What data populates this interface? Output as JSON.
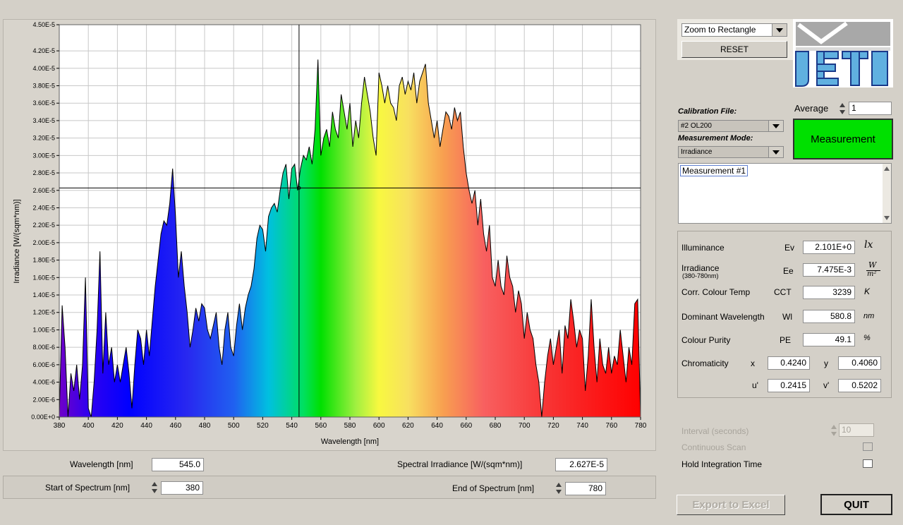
{
  "zoom": {
    "selected": "Zoom to Rectangle"
  },
  "reset_label": "RESET",
  "logo": {
    "text": "JETI"
  },
  "calibration": {
    "label": "Calibration File:",
    "selected": "#2  OL200"
  },
  "measurement_mode": {
    "label": "Measurement Mode:",
    "selected": "Irradiance"
  },
  "average": {
    "label": "Average",
    "value": "1"
  },
  "measure_button": "Measurement",
  "measurement_list": [
    "Measurement #1"
  ],
  "results": {
    "illuminance": {
      "label": "Illuminance",
      "symbol": "Ev",
      "value": "2.101E+0",
      "unit": "lx"
    },
    "irradiance": {
      "label": "Irradiance",
      "sublabel": "(380-780nm)",
      "symbol": "Ee",
      "value": "7.475E-3",
      "unit_num": "W",
      "unit_den": "m²"
    },
    "cct": {
      "label": "Corr. Colour Temp",
      "symbol": "CCT",
      "value": "3239",
      "unit": "K"
    },
    "dominant": {
      "label": "Dominant Wavelength",
      "symbol": "Wl",
      "value": "580.8",
      "unit": "nm"
    },
    "purity": {
      "label": "Colour Purity",
      "symbol": "PE",
      "value": "49.1",
      "unit": "%"
    },
    "chromaticity": {
      "label": "Chromaticity",
      "x_label": "x",
      "x": "0.4240",
      "y_label": "y",
      "y": "0.4060",
      "u_label": "u'",
      "u": "0.2415",
      "v_label": "v'",
      "v": "0.5202"
    }
  },
  "interval": {
    "label": "Interval  (seconds)",
    "value": "10"
  },
  "continuous_scan": {
    "label": "Continuous Scan",
    "checked": false
  },
  "hold_integration": {
    "label": "Hold Integration Time",
    "checked": false
  },
  "export_label": "Export to Excel",
  "quit_label": "QUIT",
  "cursor": {
    "wavelength_label": "Wavelength [nm]",
    "wavelength": "545.0",
    "irradiance_label": "Spectral Irradiance [W/(sqm*nm)]",
    "irradiance": "2.627E-5"
  },
  "range": {
    "start_label": "Start of Spectrum [nm]",
    "start": "380",
    "end_label": "End of Spectrum [nm]",
    "end": "780"
  },
  "chart_data": {
    "type": "area",
    "title": "",
    "xlabel": "Wavelength [nm]",
    "ylabel": "Irradiance [W/(sqm*nm)]",
    "xlim": [
      380,
      780
    ],
    "ylim": [
      0,
      4.5e-05
    ],
    "grid": true,
    "fill": "visible-spectrum gradient",
    "x_ticks": [
      "380",
      "400",
      "420",
      "440",
      "460",
      "480",
      "500",
      "520",
      "540",
      "560",
      "580",
      "600",
      "620",
      "640",
      "660",
      "680",
      "700",
      "720",
      "740",
      "760",
      "780"
    ],
    "y_ticks": [
      "0.00E+0",
      "2.00E-6",
      "4.00E-6",
      "6.00E-6",
      "8.00E-6",
      "1.00E-5",
      "1.20E-5",
      "1.40E-5",
      "1.60E-5",
      "1.80E-5",
      "2.00E-5",
      "2.20E-5",
      "2.40E-5",
      "2.60E-5",
      "2.80E-5",
      "3.00E-5",
      "3.20E-5",
      "3.40E-5",
      "3.60E-5",
      "3.80E-5",
      "4.00E-5",
      "4.20E-5",
      "4.50E-5"
    ],
    "cursor": {
      "x": 545.0,
      "y": 2.627e-05
    },
    "x": [
      380,
      382,
      384,
      386,
      388,
      390,
      392,
      394,
      396,
      398,
      400,
      402,
      404,
      406,
      408,
      410,
      412,
      414,
      416,
      418,
      420,
      422,
      424,
      426,
      428,
      430,
      432,
      434,
      436,
      438,
      440,
      442,
      444,
      446,
      448,
      450,
      452,
      454,
      456,
      458,
      460,
      462,
      464,
      466,
      468,
      470,
      472,
      474,
      476,
      478,
      480,
      482,
      484,
      486,
      488,
      490,
      492,
      494,
      496,
      498,
      500,
      502,
      504,
      506,
      508,
      510,
      512,
      514,
      516,
      518,
      520,
      522,
      524,
      526,
      528,
      530,
      532,
      534,
      536,
      538,
      540,
      542,
      544,
      546,
      548,
      550,
      552,
      554,
      556,
      558,
      560,
      562,
      564,
      566,
      568,
      570,
      572,
      574,
      576,
      578,
      580,
      582,
      584,
      586,
      588,
      590,
      592,
      594,
      596,
      598,
      600,
      602,
      604,
      606,
      608,
      610,
      612,
      614,
      616,
      618,
      620,
      622,
      624,
      626,
      628,
      630,
      632,
      634,
      636,
      638,
      640,
      642,
      644,
      646,
      648,
      650,
      652,
      654,
      656,
      658,
      660,
      662,
      664,
      666,
      668,
      670,
      672,
      674,
      676,
      678,
      680,
      682,
      684,
      686,
      688,
      690,
      692,
      694,
      696,
      698,
      700,
      702,
      704,
      706,
      708,
      710,
      712,
      714,
      716,
      718,
      720,
      722,
      724,
      726,
      728,
      730,
      732,
      734,
      736,
      738,
      740,
      742,
      744,
      746,
      748,
      750,
      752,
      754,
      756,
      758,
      760,
      762,
      764,
      766,
      768,
      770,
      772,
      774,
      776,
      778,
      780
    ],
    "values": [
      0.0,
      1.28e-05,
      8e-06,
      0.0,
      5e-06,
      3e-06,
      6e-06,
      2e-06,
      6e-06,
      1.6e-05,
      1e-06,
      0.0,
      4e-06,
      1e-05,
      1.9e-05,
      5e-06,
      1.2e-05,
      6e-06,
      8e-06,
      4e-06,
      6e-06,
      4e-06,
      6e-06,
      8e-06,
      5e-06,
      1e-06,
      6e-06,
      1e-05,
      9e-06,
      6e-06,
      1e-05,
      7e-06,
      1.1e-05,
      1.5e-05,
      1.8e-05,
      2.1e-05,
      2.25e-05,
      2.2e-05,
      2.45e-05,
      2.85e-05,
      2.3e-05,
      1.6e-05,
      1.9e-05,
      1.5e-05,
      1.2e-05,
      8e-06,
      1e-05,
      1.25e-05,
      1.1e-05,
      1.3e-05,
      1.25e-05,
      1e-05,
      9e-06,
      1.05e-05,
      1.2e-05,
      8e-06,
      6e-06,
      1e-05,
      1.2e-05,
      8e-06,
      7e-06,
      1.05e-05,
      1.3e-05,
      1e-05,
      1.25e-05,
      1.4e-05,
      1.5e-05,
      1.7e-05,
      2.05e-05,
      2.2e-05,
      2.15e-05,
      1.9e-05,
      2.3e-05,
      2.4e-05,
      2.45e-05,
      2.35e-05,
      2.6e-05,
      2.8e-05,
      2.9e-05,
      2.5e-05,
      2.85e-05,
      2.9e-05,
      2.6e-05,
      2.85e-05,
      3e-05,
      2.95e-05,
      3.1e-05,
      2.9e-05,
      3.3e-05,
      4.1e-05,
      3e-05,
      3.2e-05,
      3.3e-05,
      3.1e-05,
      3.5e-05,
      3.3e-05,
      3.2e-05,
      3.7e-05,
      3.5e-05,
      3.3e-05,
      3.6e-05,
      3.1e-05,
      3.4e-05,
      3.2e-05,
      3.6e-05,
      3.9e-05,
      3.7e-05,
      3.5e-05,
      3.2e-05,
      3e-05,
      3.95e-05,
      3.8e-05,
      3.6e-05,
      3.8e-05,
      3.6e-05,
      3.55e-05,
      3.4e-05,
      3.8e-05,
      3.9e-05,
      3.7e-05,
      3.85e-05,
      3.75e-05,
      3.95e-05,
      3.6e-05,
      3.85e-05,
      3.95e-05,
      4.05e-05,
      3.6e-05,
      3.4e-05,
      3.2e-05,
      3.4e-05,
      3.1e-05,
      3.3e-05,
      3.5e-05,
      3.45e-05,
      3.3e-05,
      3.55e-05,
      3.4e-05,
      3.5e-05,
      3.1e-05,
      2.8e-05,
      2.6e-05,
      2.45e-05,
      2.6e-05,
      2.2e-05,
      2.5e-05,
      2.1e-05,
      1.9e-05,
      2.2e-05,
      1.6e-05,
      1.5e-05,
      1.8e-05,
      1.5e-05,
      1.4e-05,
      1.85e-05,
      1.6e-05,
      1.5e-05,
      1.2e-05,
      1.45e-05,
      1.3e-05,
      9e-06,
      1.2e-05,
      1e-05,
      9e-06,
      6e-06,
      4e-06,
      0.0,
      4e-06,
      7e-06,
      9e-06,
      6e-06,
      8e-06,
      1e-05,
      5e-06,
      1.05e-05,
      9e-06,
      1.35e-05,
      1.1e-05,
      8e-06,
      1e-05,
      9e-06,
      3e-06,
      7e-06,
      1.35e-05,
      8e-06,
      4e-06,
      9e-06,
      6e-06,
      5e-06,
      8e-06,
      5e-06,
      7e-06,
      6e-06,
      1e-05,
      7e-06,
      4e-06,
      8e-06,
      6e-06,
      1.3e-05,
      1.35e-05,
      0.0
    ]
  }
}
